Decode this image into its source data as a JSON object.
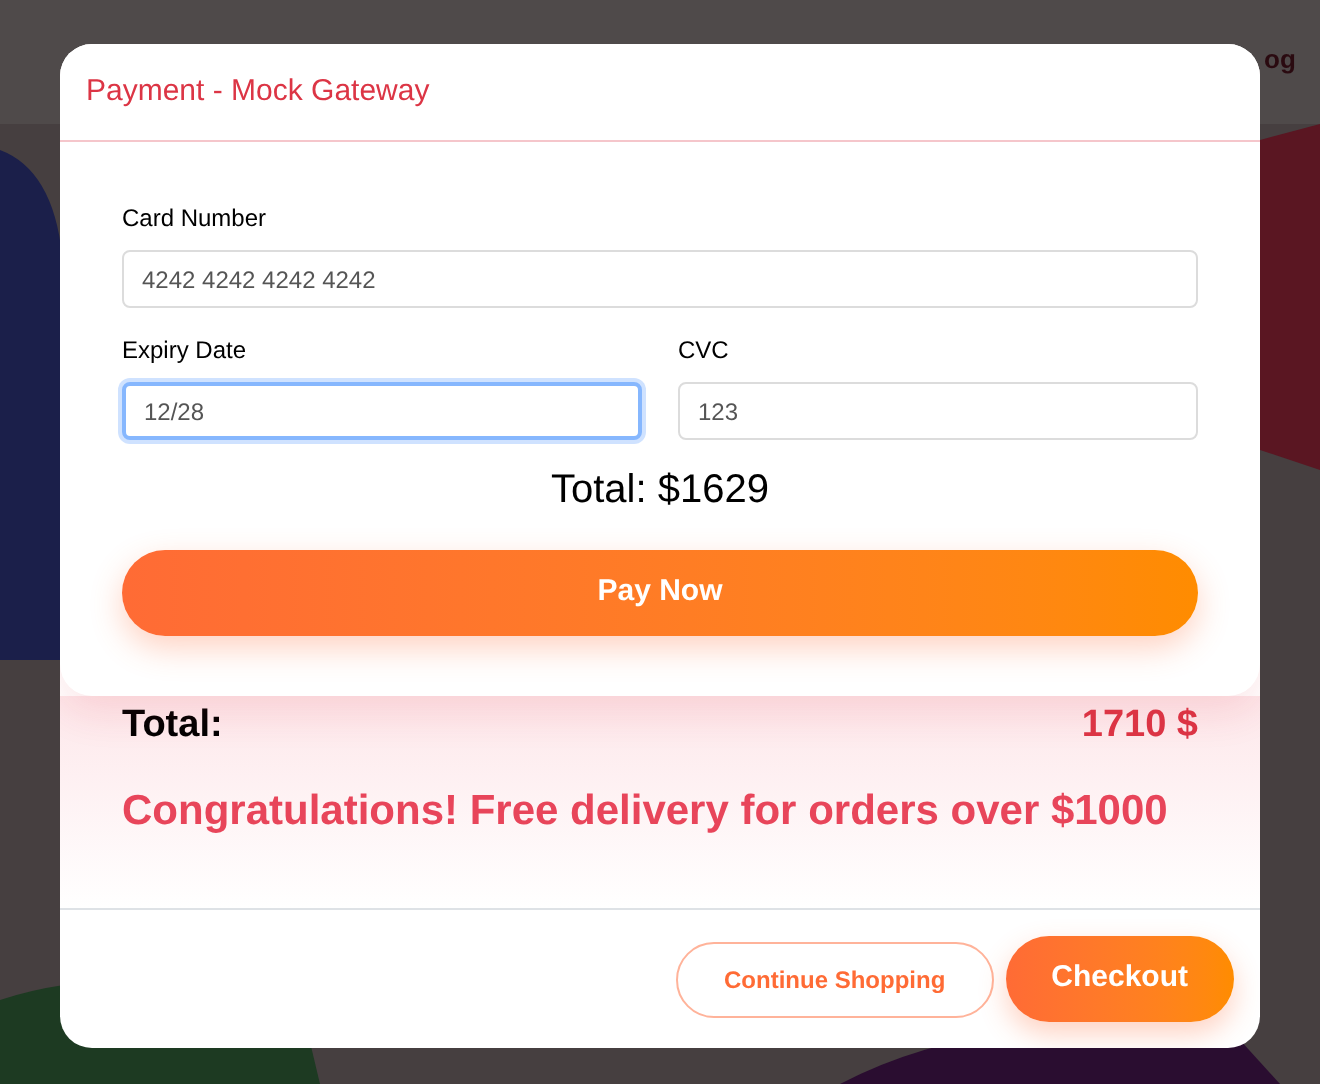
{
  "background": {
    "header_link": "og"
  },
  "payment": {
    "title": "Payment - Mock Gateway",
    "fields": [
      {
        "label": "Card Number",
        "value": "4242 4242 4242 4242",
        "focused": false
      },
      {
        "label": "Expiry Date",
        "value": "12/28",
        "focused": true
      },
      {
        "label": "CVC",
        "value": "123",
        "focused": false
      }
    ],
    "total": "Total: $1629",
    "button": "Pay Now"
  },
  "cart": {
    "total_label": "Total:",
    "total_value": "1710 $",
    "message": "Congratulations! Free delivery for orders over $1000",
    "buttons": [
      {
        "label": "Continue Shopping",
        "kind": "outline"
      },
      {
        "label": "Checkout",
        "kind": "primary"
      }
    ]
  }
}
